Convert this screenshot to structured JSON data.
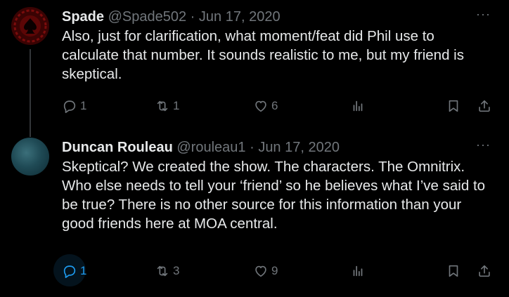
{
  "tweets": [
    {
      "name": "Spade",
      "handle": "@Spade502",
      "separator": "·",
      "date": "Jun 17, 2020",
      "text": "Also, just for clarification, what moment/feat did Phil use to calculate that number. It sounds realistic to me, but my friend is skeptical.",
      "replies": "1",
      "retweets": "1",
      "likes": "6"
    },
    {
      "name": "Duncan Rouleau",
      "handle": "@rouleau1",
      "separator": "·",
      "date": "Jun 17, 2020",
      "text": "Skeptical? We created the show. The characters. The Omnitrix. Who else needs to tell your ‘friend’ so he believes what I’ve said to be true? There is no other source for this information than your good friends here at MOA central.",
      "replies": "1",
      "retweets": "3",
      "likes": "9"
    }
  ],
  "more_label": "···",
  "colors": {
    "background": "#000000",
    "text": "#e7e9ea",
    "muted": "#71767b",
    "accent": "#1d9bf0"
  },
  "icons": [
    "reply-icon",
    "retweet-icon",
    "like-icon",
    "views-icon",
    "bookmark-icon",
    "share-icon",
    "more-icon"
  ]
}
